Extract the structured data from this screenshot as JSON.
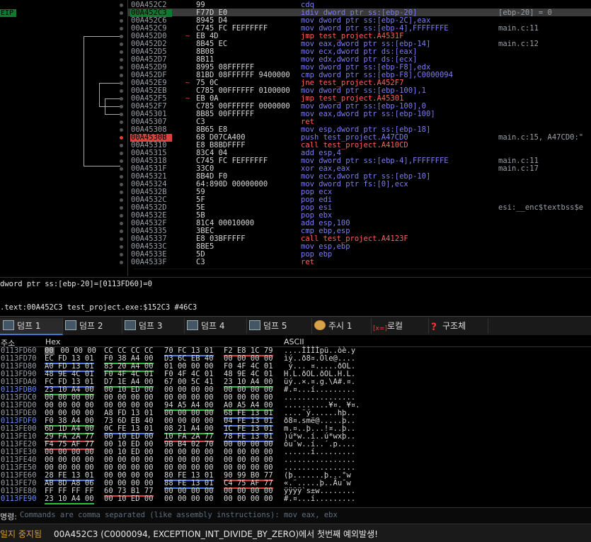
{
  "disasm": {
    "eip_label": "EIP",
    "rows": [
      {
        "addr": "00A452C2",
        "bytes": "99",
        "instr": "cdq",
        "cmt": "",
        "style": "",
        "arrow": "",
        "dot": "",
        "addr_style": ""
      },
      {
        "addr": "00A452C3",
        "bytes": "F77D E0",
        "instr": "idiv dword ptr ss:[ebp-20]",
        "cmt": "[ebp-20] = 0",
        "style": "",
        "arrow": "",
        "dot": "",
        "addr_style": "cur"
      },
      {
        "addr": "00A452C6",
        "bytes": "8945 D4",
        "instr": "mov dword ptr ss:[ebp-2C],eax",
        "cmt": "",
        "style": "",
        "arrow": "",
        "dot": "",
        "addr_style": ""
      },
      {
        "addr": "00A452C9",
        "bytes": "C745 FC FEFFFFFF",
        "instr": "mov dword ptr ss:[ebp-4],FFFFFFFE",
        "cmt": "main.c:11",
        "style": "",
        "arrow": "",
        "dot": "",
        "addr_style": ""
      },
      {
        "addr": "00A452D0",
        "bytes": "EB 4D",
        "instr": "jmp test_project.A4531F",
        "cmt": "",
        "style": "red",
        "arrow": "~",
        "dot": "",
        "addr_style": ""
      },
      {
        "addr": "00A452D2",
        "bytes": "8B45 EC",
        "instr": "mov eax,dword ptr ss:[ebp-14]",
        "cmt": "main.c:12",
        "style": "",
        "arrow": "",
        "dot": "",
        "addr_style": ""
      },
      {
        "addr": "00A452D5",
        "bytes": "8B08",
        "instr": "mov ecx,dword ptr ds:[eax]",
        "cmt": "",
        "style": "",
        "arrow": "",
        "dot": "",
        "addr_style": ""
      },
      {
        "addr": "00A452D7",
        "bytes": "8B11",
        "instr": "mov edx,dword ptr ds:[ecx]",
        "cmt": "",
        "style": "",
        "arrow": "",
        "dot": "",
        "addr_style": ""
      },
      {
        "addr": "00A452D9",
        "bytes": "8995 08FFFFFF",
        "instr": "mov dword ptr ss:[ebp-F8],edx",
        "cmt": "",
        "style": "",
        "arrow": "",
        "dot": "",
        "addr_style": ""
      },
      {
        "addr": "00A452DF",
        "bytes": "81BD 08FFFFFF 9400000",
        "instr": "cmp dword ptr ss:[ebp-F8],C0000094",
        "cmt": "",
        "style": "",
        "arrow": "",
        "dot": "",
        "addr_style": ""
      },
      {
        "addr": "00A452E9",
        "bytes": "75 0C",
        "instr": "jne test_project.A452F7",
        "cmt": "",
        "style": "red",
        "arrow": "~",
        "dot": "",
        "addr_style": ""
      },
      {
        "addr": "00A452EB",
        "bytes": "C785 00FFFFFF 0100000",
        "instr": "mov dword ptr ss:[ebp-100],1",
        "cmt": "",
        "style": "",
        "arrow": "",
        "dot": "",
        "addr_style": ""
      },
      {
        "addr": "00A452F5",
        "bytes": "EB 0A",
        "instr": "jmp test_project.A45301",
        "cmt": "",
        "style": "red",
        "arrow": "~",
        "dot": "",
        "addr_style": ""
      },
      {
        "addr": "00A452F7",
        "bytes": "C785 00FFFFFF 0000000",
        "instr": "mov dword ptr ss:[ebp-100],0",
        "cmt": "",
        "style": "",
        "arrow": "",
        "dot": "",
        "addr_style": ""
      },
      {
        "addr": "00A45301",
        "bytes": "8B85 00FFFFFF",
        "instr": "mov eax,dword ptr ss:[ebp-100]",
        "cmt": "",
        "style": "",
        "arrow": "",
        "dot": "",
        "addr_style": ""
      },
      {
        "addr": "00A45307",
        "bytes": "C3",
        "instr": "ret",
        "cmt": "",
        "style": "red",
        "arrow": "",
        "dot": "",
        "addr_style": ""
      },
      {
        "addr": "00A45308",
        "bytes": "8B65 E8",
        "instr": "mov esp,dword ptr ss:[ebp-18]",
        "cmt": "",
        "style": "",
        "arrow": "",
        "dot": "",
        "addr_style": ""
      },
      {
        "addr": "00A4530B",
        "bytes": "68 D07CA400",
        "instr": "push test_project.A47CD0",
        "cmt": "main.c:15, A47CD0:\"",
        "style": "",
        "arrow": "",
        "dot": "bp",
        "addr_style": "bp"
      },
      {
        "addr": "00A45310",
        "bytes": "E8 B8BDFFFF",
        "instr": "call test_project.A410CD",
        "cmt": "",
        "style": "red",
        "arrow": "",
        "dot": "",
        "addr_style": ""
      },
      {
        "addr": "00A45315",
        "bytes": "83C4 04",
        "instr": "add esp,4",
        "cmt": "",
        "style": "",
        "arrow": "",
        "dot": "",
        "addr_style": ""
      },
      {
        "addr": "00A45318",
        "bytes": "C745 FC FEFFFFFF",
        "instr": "mov dword ptr ss:[ebp-4],FFFFFFFE",
        "cmt": "main.c:11",
        "style": "",
        "arrow": "",
        "dot": "",
        "addr_style": ""
      },
      {
        "addr": "00A4531F",
        "bytes": "33C0",
        "instr": "xor eax,eax",
        "cmt": "main.c:17",
        "style": "",
        "arrow": "",
        "dot": "",
        "addr_style": ""
      },
      {
        "addr": "00A45321",
        "bytes": "8B4D F0",
        "instr": "mov ecx,dword ptr ss:[ebp-10]",
        "cmt": "",
        "style": "",
        "arrow": "",
        "dot": "",
        "addr_style": ""
      },
      {
        "addr": "00A45324",
        "bytes": "64:890D 00000000",
        "instr": "mov dword ptr fs:[0],ecx",
        "cmt": "",
        "style": "",
        "arrow": "",
        "dot": "",
        "addr_style": ""
      },
      {
        "addr": "00A4532B",
        "bytes": "59",
        "instr": "pop ecx",
        "cmt": "",
        "style": "",
        "arrow": "",
        "dot": "",
        "addr_style": ""
      },
      {
        "addr": "00A4532C",
        "bytes": "5F",
        "instr": "pop edi",
        "cmt": "",
        "style": "",
        "arrow": "",
        "dot": "",
        "addr_style": ""
      },
      {
        "addr": "00A4532D",
        "bytes": "5E",
        "instr": "pop esi",
        "cmt": "esi:__enc$textbss$e",
        "style": "",
        "arrow": "",
        "dot": "",
        "addr_style": ""
      },
      {
        "addr": "00A4532E",
        "bytes": "5B",
        "instr": "pop ebx",
        "cmt": "",
        "style": "",
        "arrow": "",
        "dot": "",
        "addr_style": ""
      },
      {
        "addr": "00A4532F",
        "bytes": "81C4 00010000",
        "instr": "add esp,100",
        "cmt": "",
        "style": "",
        "arrow": "",
        "dot": "",
        "addr_style": ""
      },
      {
        "addr": "00A45335",
        "bytes": "3BEC",
        "instr": "cmp ebp,esp",
        "cmt": "",
        "style": "",
        "arrow": "",
        "dot": "",
        "addr_style": ""
      },
      {
        "addr": "00A45337",
        "bytes": "E8 03BFFFFF",
        "instr": "call test_project.A4123F",
        "cmt": "",
        "style": "red",
        "arrow": "",
        "dot": "",
        "addr_style": ""
      },
      {
        "addr": "00A4533C",
        "bytes": "8BE5",
        "instr": "mov esp,ebp",
        "cmt": "",
        "style": "",
        "arrow": "",
        "dot": "",
        "addr_style": ""
      },
      {
        "addr": "00A4533E",
        "bytes": "5D",
        "instr": "pop ebp",
        "cmt": "",
        "style": "",
        "arrow": "",
        "dot": "",
        "addr_style": ""
      },
      {
        "addr": "00A4533F",
        "bytes": "C3",
        "instr": "ret",
        "cmt": "",
        "style": "red",
        "arrow": "",
        "dot": "",
        "addr_style": ""
      }
    ]
  },
  "info": {
    "line1": "dword ptr ss:[ebp-20]=[0113FD60]=0",
    "line2": ".text:00A452C3 test_project.exe:$152C3 #46C3"
  },
  "tabs": [
    {
      "label": "덤프 1",
      "icon": "dump-icon",
      "active": true
    },
    {
      "label": "덤프 2",
      "icon": "dump-icon",
      "active": false
    },
    {
      "label": "덤프 3",
      "icon": "dump-icon",
      "active": false
    },
    {
      "label": "덤프 4",
      "icon": "dump-icon",
      "active": false
    },
    {
      "label": "덤프 5",
      "icon": "dump-icon",
      "active": false
    },
    {
      "label": "주시 1",
      "icon": "watch-icon",
      "active": false
    },
    {
      "label": "로컬",
      "icon": "locals-icon",
      "active": false
    },
    {
      "label": "구조체",
      "icon": "struct-icon",
      "active": false
    }
  ],
  "dump": {
    "headers": {
      "addr": "주소",
      "hex": "Hex",
      "ascii": "ASCII"
    },
    "rows": [
      {
        "addr": "0113FD60",
        "blue": false,
        "g": [
          "00 00 00 00",
          "CC CC CC CC",
          "70 FC 13 01",
          "F2 E8 1C 79"
        ],
        "u": [
          "",
          "",
          "blue",
          "red"
        ],
        "sel0": true,
        "ascii": "....ÌÌÌÌpü..òè.y"
      },
      {
        "addr": "0113FD70",
        "blue": false,
        "g": [
          "EC FD 13 01",
          "F0 38 A4 00",
          "D3 6C EB 40",
          "00 00 00 00"
        ],
        "u": [
          "blue",
          "green",
          "",
          ""
        ],
        "ascii": "ìý..ð8¤.Óle@...."
      },
      {
        "addr": "0113FD80",
        "blue": false,
        "g": [
          "A0 FD 13 01",
          "83 20 A4 00",
          "01 00 00 00",
          "F0 4F 4C 01"
        ],
        "u": [
          "blue",
          "green",
          "",
          ""
        ],
        "ascii": " ý... ¤.....ðOL."
      },
      {
        "addr": "0113FD90",
        "blue": false,
        "g": [
          "48 9E 4C 01",
          "F0 4F 4C 01",
          "F0 4F 4C 01",
          "48 9E 4C 01"
        ],
        "u": [
          "",
          "",
          "",
          ""
        ],
        "ascii": "H.L.ðOL.ðOL.H.L."
      },
      {
        "addr": "0113FDA0",
        "blue": false,
        "g": [
          "FC FD 13 01",
          "D7 1E A4 00",
          "67 00 5C 41",
          "23 10 A4 00"
        ],
        "u": [
          "blue",
          "green",
          "",
          "green"
        ],
        "ascii": "üý..×.¤.g.\\A#.¤."
      },
      {
        "addr": "0113FDB0",
        "blue": true,
        "g": [
          "23 10 A4 00",
          "00 10 ED 00",
          "00 00 00 00",
          "00 00 00 00"
        ],
        "u": [
          "green",
          "",
          "",
          ""
        ],
        "ascii": "#.¤...í........."
      },
      {
        "addr": "0113FDC0",
        "blue": false,
        "g": [
          "00 00 00 00",
          "00 00 00 00",
          "00 00 00 00",
          "00 00 00 00"
        ],
        "u": [
          "",
          "",
          "",
          ""
        ],
        "ascii": "................"
      },
      {
        "addr": "0113FDD0",
        "blue": false,
        "g": [
          "00 00 00 00",
          "00 00 00 00",
          "94 A5 A4 00",
          "A0 A5 A4 00"
        ],
        "u": [
          "",
          "",
          "green",
          "green"
        ],
        "ascii": "..........¥¤. ¥¤."
      },
      {
        "addr": "0113FDE0",
        "blue": false,
        "g": [
          "00 00 00 00",
          "A8 FD 13 01",
          "00 00 00 00",
          "68 FE 13 01"
        ],
        "u": [
          "",
          "",
          "",
          "blue"
        ],
        "ascii": "....¨ý......hþ.."
      },
      {
        "addr": "0113FDF0",
        "blue": true,
        "g": [
          "F0 38 A4 00",
          "73 6D EB 40",
          "00 00 00 00",
          "04 FE 13 01"
        ],
        "u": [
          "green",
          "",
          "",
          "blue"
        ],
        "ascii": "ð8¤.smë@.....þ.."
      },
      {
        "addr": "0113FE00",
        "blue": false,
        "g": [
          "6D 1D A4 00",
          "0C FE 13 01",
          "08 21 A4 00",
          "1C FE 13 01"
        ],
        "u": [
          "green",
          "blue",
          "green",
          "blue"
        ],
        "ascii": "m.¤..þ...!¤..þ.."
      },
      {
        "addr": "0113FE10",
        "blue": false,
        "g": [
          "29 FA 2A 77",
          "00 10 ED 00",
          "10 FA 2A 77",
          "78 FE 13 01"
        ],
        "u": [
          "red",
          "",
          "red",
          "blue"
        ],
        "ascii": ")ú*w..í..ú*wxþ.."
      },
      {
        "addr": "0113FE20",
        "blue": false,
        "g": [
          "F4 75 AF 77",
          "00 10 ED 00",
          "9B B4 02 70",
          "00 00 00 00"
        ],
        "u": [
          "red",
          "",
          "",
          ""
        ],
        "ascii": "ôu¯w..í..´.p...."
      },
      {
        "addr": "0113FE30",
        "blue": false,
        "g": [
          "00 00 00 00",
          "00 10 ED 00",
          "00 00 00 00",
          "00 00 00 00"
        ],
        "u": [
          "",
          "",
          "",
          ""
        ],
        "ascii": "......í........."
      },
      {
        "addr": "0113FE40",
        "blue": false,
        "g": [
          "00 00 00 00",
          "00 00 00 00",
          "00 00 00 00",
          "00 00 00 00"
        ],
        "u": [
          "",
          "",
          "",
          ""
        ],
        "ascii": "................"
      },
      {
        "addr": "0113FE50",
        "blue": false,
        "g": [
          "00 00 00 00",
          "00 00 00 00",
          "00 00 00 00",
          "00 00 00 00"
        ],
        "u": [
          "",
          "",
          "",
          ""
        ],
        "ascii": "................"
      },
      {
        "addr": "0113FE60",
        "blue": false,
        "g": [
          "28 FE 13 01",
          "00 00 00 00",
          "80 FE 13 01",
          "90 99 B0 77"
        ],
        "u": [
          "blue",
          "",
          "blue",
          "red"
        ],
        "ascii": "(þ.......þ...°w"
      },
      {
        "addr": "0113FE70",
        "blue": false,
        "g": [
          "AB 8D A8 06",
          "00 00 00 00",
          "88 FE 13 01",
          "C4 75 AF 77"
        ],
        "u": [
          "",
          "",
          "blue",
          "red"
        ],
        "ascii": "«.¨.....þ..Äu¯w"
      },
      {
        "addr": "0113FE80",
        "blue": false,
        "g": [
          "FF FF FF FF",
          "60 73 B1 77",
          "00 00 00 00",
          "00 00 00 00"
        ],
        "u": [
          "",
          "red",
          "",
          ""
        ],
        "ascii": "ÿÿÿÿ`s±w........"
      },
      {
        "addr": "0113FE90",
        "blue": true,
        "g": [
          "23 10 A4 00",
          "00 10 ED 00",
          "00 00 00 00",
          "00 00 00 00"
        ],
        "u": [
          "green",
          "",
          "",
          ""
        ],
        "ascii": "#.¤...í........."
      }
    ]
  },
  "command": {
    "label": "명령:",
    "placeholder": "Commands are comma separated (like assembly instructions): mov eax, ebx"
  },
  "status": {
    "state": "일지 중지됨",
    "message": "00A452C3 (C0000094, EXCEPTION_INT_DIVIDE_BY_ZERO)에서 첫번째 예외발생!"
  },
  "colors": {
    "eip_green": "#0f7a2f",
    "breakpoint_red": "#e0403a",
    "instr_blue": "#7d7df0",
    "instr_red": "#ff6060",
    "status_orange": "#d8a02e"
  }
}
